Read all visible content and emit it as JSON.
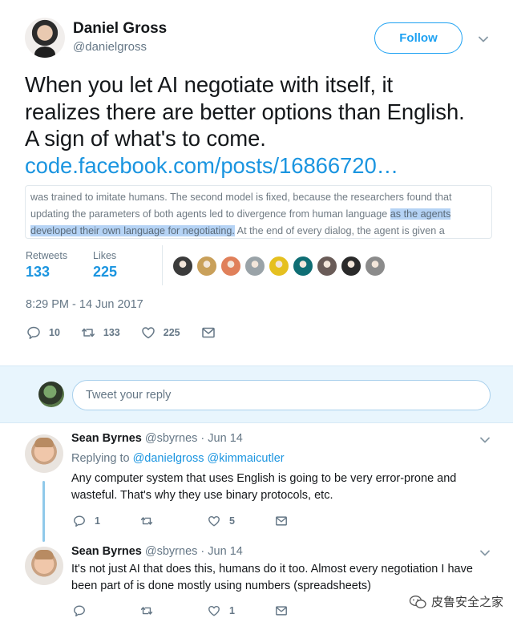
{
  "tweet": {
    "author_name": "Daniel Gross",
    "author_handle": "@danielgross",
    "follow_label": "Follow",
    "text_lines": [
      "When you let AI negotiate with itself, it",
      "realizes there are better options than English.",
      "A sign of what's to come."
    ],
    "link_text": "code.facebook.com/posts/16866720…",
    "quote": {
      "line1": "was trained to imitate humans. The second model is fixed, because the researchers found that",
      "line2_before": "updating the parameters of both agents led to divergence from human language ",
      "line2_highlight": "as the agents",
      "line3_highlight": "developed their own language for negotiating.",
      "line3_after": " At the end of every dialog, the agent is given a"
    },
    "retweets_label": "Retweets",
    "retweets_count": "133",
    "likes_label": "Likes",
    "likes_count": "225",
    "liker_colors": [
      "#3b3b3b",
      "#c9a05a",
      "#e0805a",
      "#9aa3a8",
      "#e5c020",
      "#0f6e74",
      "#6a5c58",
      "#2a2a2a",
      "#8b8b8b"
    ],
    "timestamp": "8:29 PM - 14 Jun 2017",
    "actions": {
      "reply_count": "10",
      "retweet_count": "133",
      "like_count": "225"
    }
  },
  "reply_box": {
    "placeholder": "Tweet your reply"
  },
  "replies": [
    {
      "name": "Sean Byrnes",
      "handle": "@sbyrnes",
      "sep": "·",
      "date": "Jun 14",
      "replying_label": "Replying to",
      "mention_1": "@danielgross",
      "mention_2": "@kimmaicutler",
      "line1": "Any computer system that uses English is going to be very error-prone and",
      "line2": "wasteful. That's why they use binary protocols, etc.",
      "reply_count": "1",
      "retweet_count": "",
      "like_count": "5"
    },
    {
      "name": "Sean Byrnes",
      "handle": "@sbyrnes",
      "sep": "·",
      "date": "Jun 14",
      "line1": "It's not just AI that does this, humans do it too. Almost every negotiation I have",
      "line2": "been part of is done mostly using numbers (spreadsheets)",
      "reply_count": "0",
      "retweet_count": "",
      "like_count": "1"
    }
  ],
  "watermark": "皮鲁安全之家",
  "colors": {
    "accent": "#1da1f2",
    "link": "#1b95e0",
    "muted": "#657786",
    "reply_bg": "#e8f5fd"
  }
}
